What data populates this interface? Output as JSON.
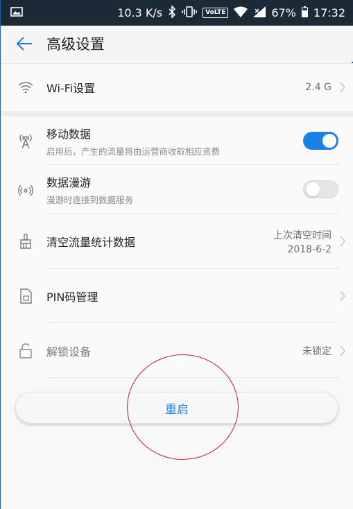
{
  "status_bar": {
    "speed": "10.3 K/s",
    "volte": "VoLTE",
    "battery": "67%",
    "time": "17:32"
  },
  "header": {
    "title": "高级设置"
  },
  "items": {
    "wifi": {
      "label": "Wi-Fi设置",
      "value": "2.4 G"
    },
    "mobile_data": {
      "label": "移动数据",
      "sub": "启用后，产生的流量将由运营商收取相应资费",
      "enabled": true
    },
    "roaming": {
      "label": "数据漫游",
      "sub": "漫游时连接到数据服务",
      "enabled": false
    },
    "clear_stats": {
      "label": "清空流量统计数据",
      "value_line1": "上次清空时间",
      "value_line2": "2018-6-2"
    },
    "pin": {
      "label": "PIN码管理"
    },
    "unlock": {
      "label": "解锁设备",
      "value": "未锁定"
    }
  },
  "restart_button": {
    "label": "重启"
  },
  "colors": {
    "accent": "#1a7fe6",
    "annotation": "#c0242a",
    "statusbar": "#1c2a38"
  }
}
